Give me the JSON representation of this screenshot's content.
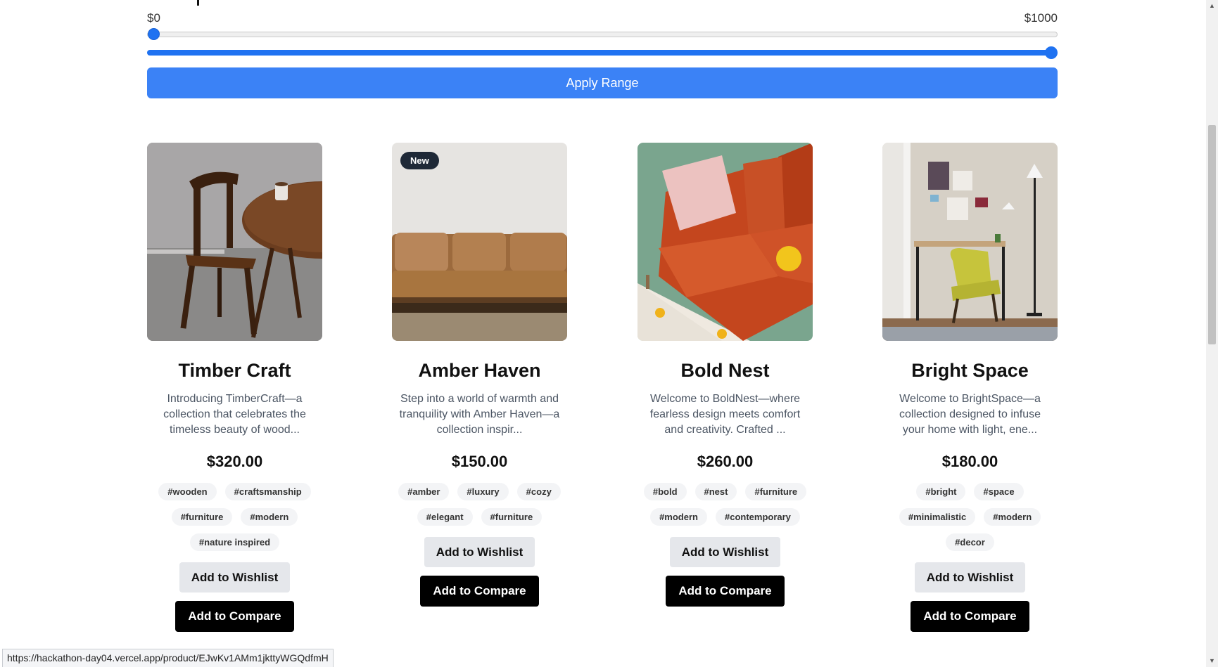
{
  "price_filter": {
    "min_label": "$0",
    "max_label": "$1000",
    "min_fraction": 0,
    "max_fraction": 1,
    "apply_label": "Apply Range"
  },
  "products": [
    {
      "title": "Timber Craft",
      "description": "Introducing TimberCraft—a collection that celebrates the timeless beauty of wood...",
      "price": "$320.00",
      "badge": "",
      "tags": [
        "#wooden",
        "#craftsmanship",
        "#furniture",
        "#modern",
        "#nature inspired"
      ],
      "wishlist_label": "Add to Wishlist",
      "compare_label": "Add to Compare",
      "image": "wooden-chair-table-photo"
    },
    {
      "title": "Amber Haven",
      "description": "Step into a world of warmth and tranquility with Amber Haven—a collection inspir...",
      "price": "$150.00",
      "badge": "New",
      "tags": [
        "#amber",
        "#luxury",
        "#cozy",
        "#elegant",
        "#furniture"
      ],
      "wishlist_label": "Add to Wishlist",
      "compare_label": "Add to Compare",
      "image": "leather-sofa-photo"
    },
    {
      "title": "Bold Nest",
      "description": "Welcome to BoldNest—where fearless design meets comfort and creativity. Crafted ...",
      "price": "$260.00",
      "badge": "",
      "tags": [
        "#bold",
        "#nest",
        "#furniture",
        "#modern",
        "#contemporary"
      ],
      "wishlist_label": "Add to Wishlist",
      "compare_label": "Add to Compare",
      "image": "orange-sofa-photo"
    },
    {
      "title": "Bright Space",
      "description": "Welcome to BrightSpace—a collection designed to infuse your home with light, ene...",
      "price": "$180.00",
      "badge": "",
      "tags": [
        "#bright",
        "#space",
        "#minimalistic",
        "#modern",
        "#decor"
      ],
      "wishlist_label": "Add to Wishlist",
      "compare_label": "Add to Compare",
      "image": "desk-yellow-chair-photo"
    }
  ],
  "status_bar": {
    "url": "https://hackathon-day04.vercel.app/product/EJwKv1AMm1jkttyWGQdfmH"
  },
  "colors": {
    "accent": "#3b82f6",
    "slider": "#1f72f1",
    "compare_button": "#000000",
    "wishlist_button": "#e5e7eb",
    "tag_bg": "#f3f4f6"
  }
}
